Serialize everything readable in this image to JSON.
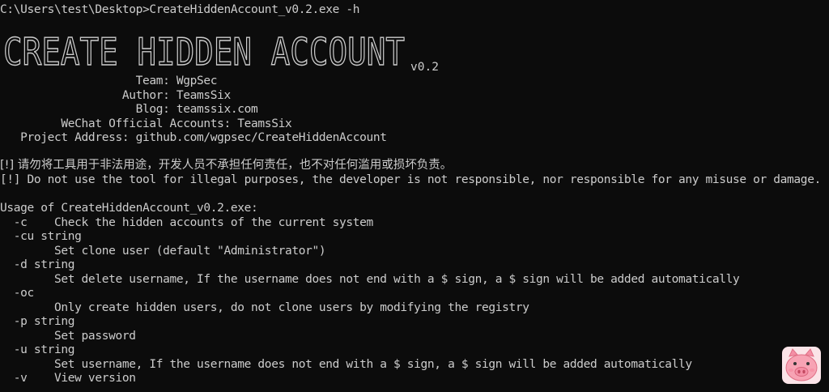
{
  "terminal": {
    "command_line": "C:\\Users\\test\\Desktop>CreateHiddenAccount_v0.2.exe -h",
    "banner": {
      "title": "CREATE HIDDEN ACCOUNT",
      "version": "v0.2"
    },
    "info": {
      "team": "                    Team: WgpSec",
      "author": "                  Author: TeamsSix",
      "blog": "                    Blog: teamssix.com",
      "wechat": "         WeChat Official Accounts: TeamsSix",
      "project": "   Project Address: github.com/wgpsec/CreateHiddenAccount"
    },
    "warnings": {
      "cn": "[!] 请勿将工具用于非法用途，开发人员不承担任何责任，也不对任何滥用或损坏负责。",
      "en": "[!] Do not use the tool for illegal purposes, the developer is not responsible, nor responsible for any misuse or damage."
    },
    "usage": {
      "header": "Usage of CreateHiddenAccount_v0.2.exe:",
      "lines": [
        "  -c    Check the hidden accounts of the current system",
        "  -cu string",
        "        Set clone user (default \"Administrator\")",
        "  -d string",
        "        Set delete username, If the username does not end with a $ sign, a $ sign will be added automatically",
        "  -oc",
        "        Only create hidden users, do not clone users by modifying the registry",
        "  -p string",
        "        Set password",
        "  -u string",
        "        Set username, If the username does not end with a $ sign, a $ sign will be added automatically",
        "  -v    View version"
      ]
    }
  },
  "colors": {
    "background": "#0c0c0c",
    "text": "#cccccc",
    "pig_face": "#f7a3b4"
  },
  "icons": {
    "overlay": "pig-icon"
  }
}
